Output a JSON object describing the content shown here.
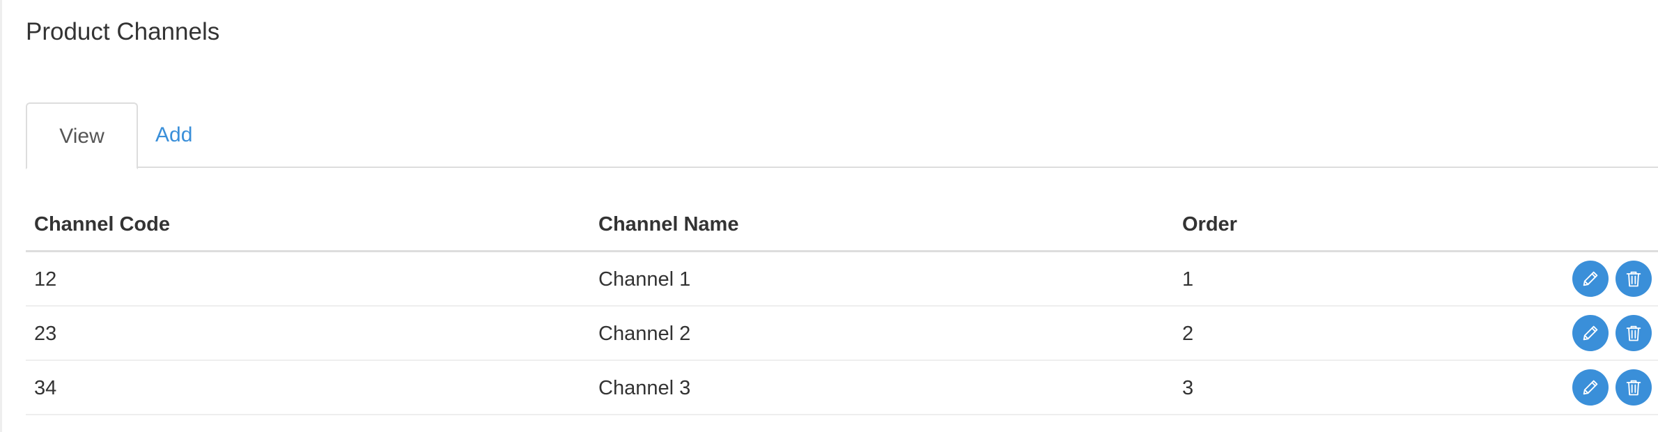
{
  "page": {
    "title": "Product Channels"
  },
  "tabs": [
    {
      "label": "View",
      "active": true
    },
    {
      "label": "Add",
      "active": false
    }
  ],
  "table": {
    "columns": [
      "Channel Code",
      "Channel Name",
      "Order"
    ],
    "rows": [
      {
        "code": "12",
        "name": "Channel 1",
        "order": "1"
      },
      {
        "code": "23",
        "name": "Channel 2",
        "order": "2"
      },
      {
        "code": "34",
        "name": "Channel 3",
        "order": "3"
      }
    ],
    "row_actions": [
      "pencil-icon",
      "trash-icon"
    ]
  },
  "colors": {
    "accent": "#3a8fd9",
    "text": "#333333",
    "border": "#dddddd"
  }
}
